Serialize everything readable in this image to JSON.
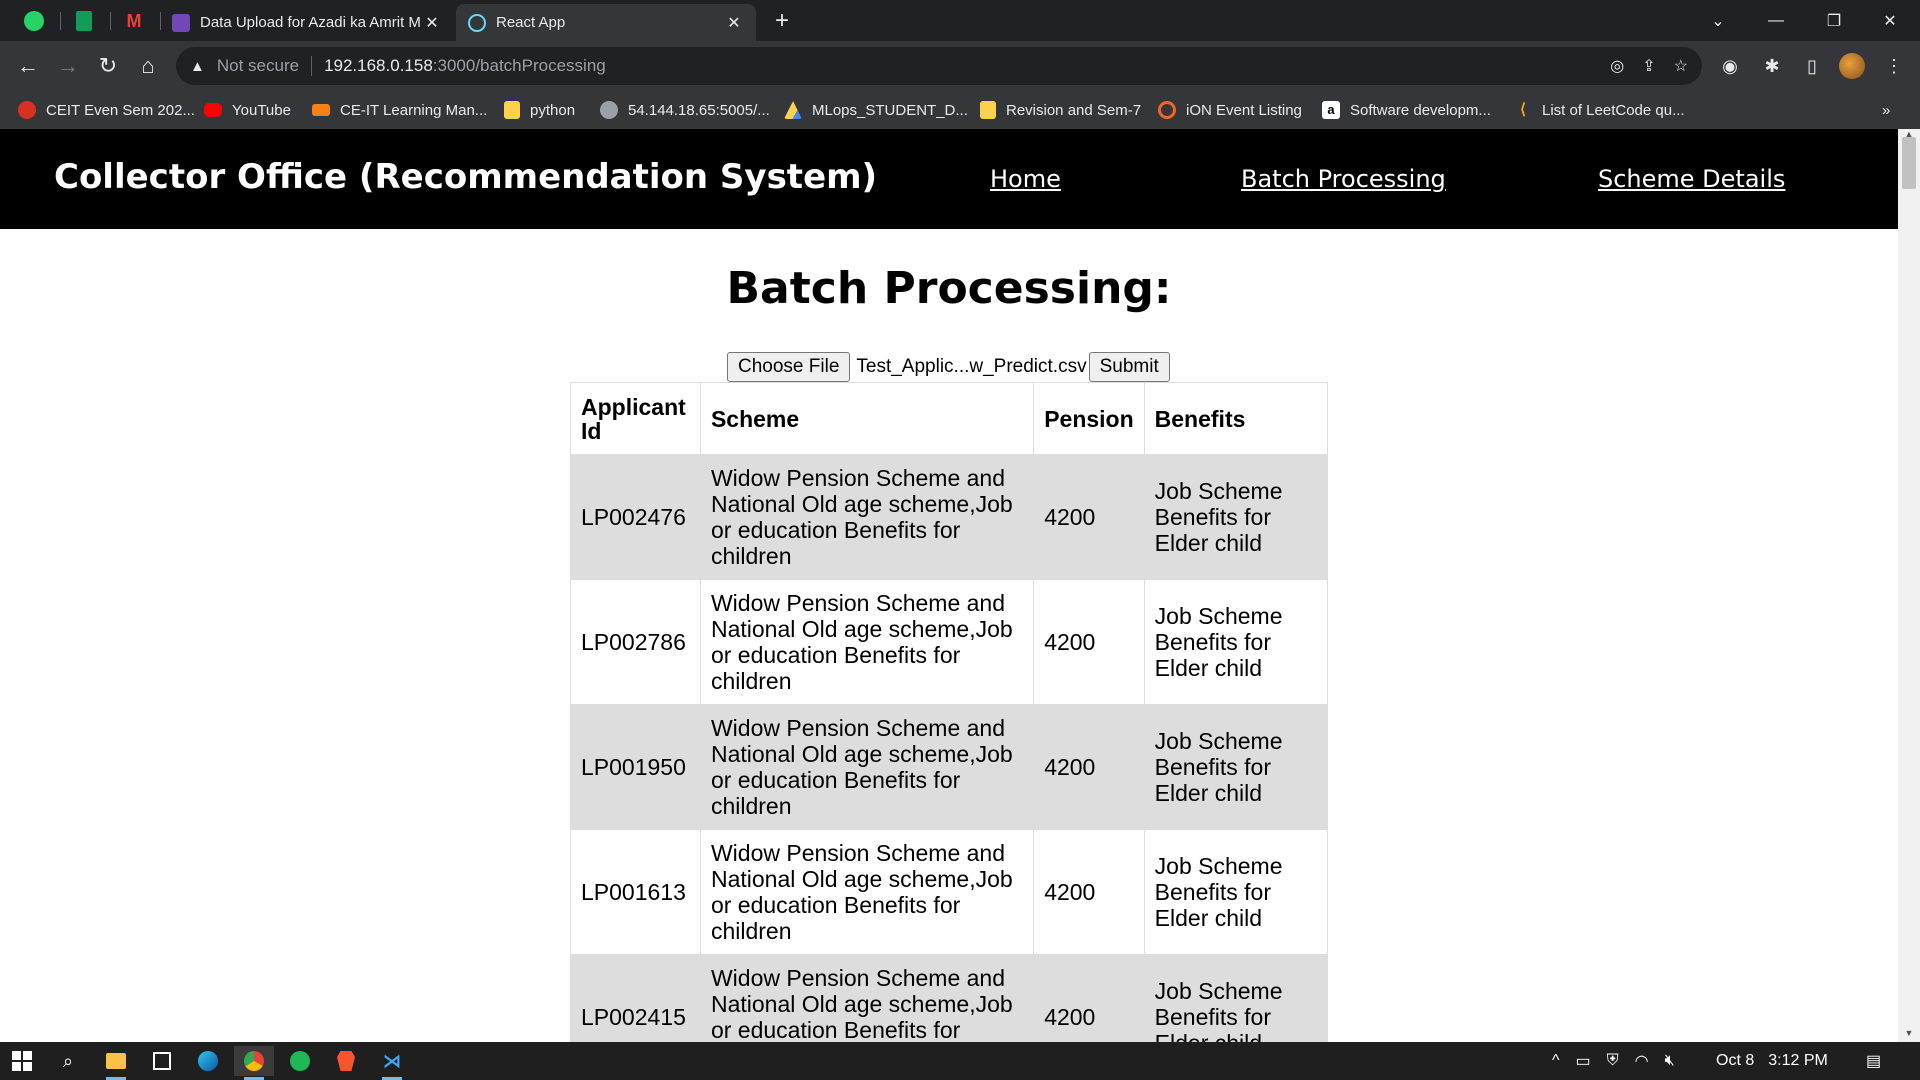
{
  "browser": {
    "tabs": [
      {
        "title": "Data Upload for Azadi ka Amrit M",
        "favicon": "forms-icon",
        "color": "#7248b9"
      },
      {
        "title": "React App",
        "favicon": "react-icon",
        "color": "#61dafb"
      }
    ],
    "pinned_tabs": [
      "whatsapp-icon",
      "sheets-icon",
      "gmail-icon"
    ],
    "address": {
      "security_label": "Not secure",
      "host": "192.168.0.158",
      "path": ":3000/batchProcessing"
    },
    "bookmarks": [
      {
        "label": "CEIT Even Sem 202...",
        "icon": "ceit-icon",
        "color": "#d93025"
      },
      {
        "label": "YouTube",
        "icon": "youtube-icon",
        "color": "#ff0000"
      },
      {
        "label": "CE-IT Learning Man...",
        "icon": "moodle-icon",
        "color": "#f98012"
      },
      {
        "label": "python",
        "icon": "folder-icon",
        "color": "#fbd249"
      },
      {
        "label": "54.144.18.65:5005/...",
        "icon": "globe-icon",
        "color": "#9aa0a6"
      },
      {
        "label": "MLops_STUDENT_D...",
        "icon": "drive-icon",
        "color": "#1fa463"
      },
      {
        "label": "Revision and Sem-7",
        "icon": "folder-icon",
        "color": "#fbd249"
      },
      {
        "label": "iON Event Listing",
        "icon": "ion-icon",
        "color": "#f26522"
      },
      {
        "label": "Software developm...",
        "icon": "amazon-icon",
        "color": "#ffffff"
      },
      {
        "label": "List of LeetCode qu...",
        "icon": "leetcode-icon",
        "color": "#ffa116"
      }
    ]
  },
  "app": {
    "brand": "Collector Office (Recommendation System)",
    "nav": {
      "home": "Home",
      "batch": "Batch Processing",
      "scheme": "Scheme Details"
    },
    "heading": "Batch Processing:",
    "upload": {
      "choose_label": "Choose File",
      "filename": "Test_Applic...w_Predict.csv",
      "submit_label": "Submit"
    },
    "table": {
      "headers": [
        "Applicant Id",
        "Scheme",
        "Pension",
        "Benefits"
      ],
      "rows": [
        {
          "id": "LP002476",
          "scheme": "Widow Pension Scheme and National Old age scheme,Job or education Benefits for children",
          "pension": "4200",
          "benefits": "Job Scheme Benefits for Elder child"
        },
        {
          "id": "LP002786",
          "scheme": "Widow Pension Scheme and National Old age scheme,Job or education Benefits for children",
          "pension": "4200",
          "benefits": "Job Scheme Benefits for Elder child"
        },
        {
          "id": "LP001950",
          "scheme": "Widow Pension Scheme and National Old age scheme,Job or education Benefits for children",
          "pension": "4200",
          "benefits": "Job Scheme Benefits for Elder child"
        },
        {
          "id": "LP001613",
          "scheme": "Widow Pension Scheme and National Old age scheme,Job or education Benefits for children",
          "pension": "4200",
          "benefits": "Job Scheme Benefits for Elder child"
        },
        {
          "id": "LP002415",
          "scheme": "Widow Pension Scheme and National Old age scheme,Job or education Benefits for children",
          "pension": "4200",
          "benefits": "Job Scheme Benefits for Elder child"
        }
      ]
    }
  },
  "taskbar": {
    "date": "Oct 8",
    "time": "3:12 PM",
    "apps": [
      "start-icon",
      "search-icon",
      "file-explorer-icon",
      "store-icon",
      "edge-icon",
      "chrome-icon",
      "spotify-icon",
      "brave-icon",
      "vscode-icon"
    ]
  }
}
